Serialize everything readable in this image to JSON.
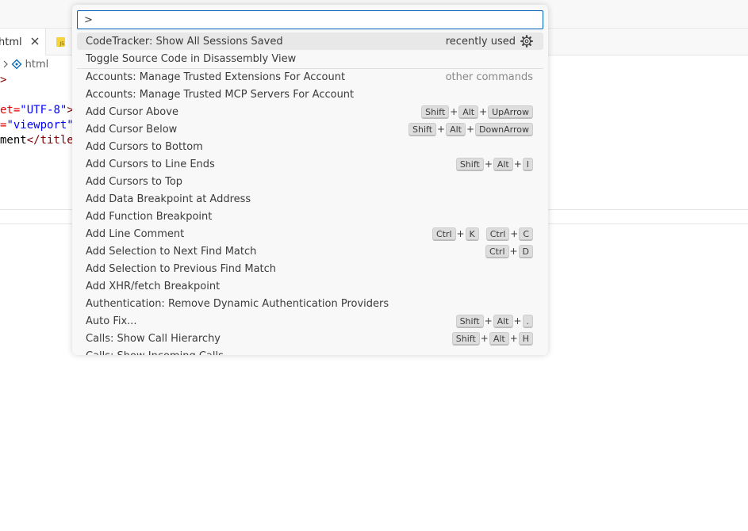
{
  "editor": {
    "active_tab_label": "html",
    "breadcrumb_prev": "l",
    "breadcrumb_current": "html",
    "code": {
      "line1_tag": ">",
      "line2_attr": "et=",
      "line2_str": "\"UTF-8\"",
      "line2_tag": ">",
      "line3_attr": "=",
      "line3_str": "\"viewport\"",
      "line4_text": "ment",
      "line4_tag": "</title"
    },
    "second_tab_icon": "js-file-icon",
    "second_tab_icon_text": "JS"
  },
  "palette": {
    "input_value": ">",
    "items": [
      {
        "label": "CodeTracker: Show All Sessions Saved",
        "note": "recently used",
        "icon": "gear-icon",
        "keys": []
      },
      {
        "label": "Toggle Source Code in Disassembly View",
        "keys": []
      },
      {
        "label": "Accounts: Manage Trusted Extensions For Account",
        "note": "other commands",
        "keys": []
      },
      {
        "label": "Accounts: Manage Trusted MCP Servers For Account",
        "keys": []
      },
      {
        "label": "Add Cursor Above",
        "keys": [
          [
            "Shift",
            "Alt",
            "UpArrow"
          ]
        ]
      },
      {
        "label": "Add Cursor Below",
        "keys": [
          [
            "Shift",
            "Alt",
            "DownArrow"
          ]
        ]
      },
      {
        "label": "Add Cursors to Bottom",
        "keys": []
      },
      {
        "label": "Add Cursors to Line Ends",
        "keys": [
          [
            "Shift",
            "Alt",
            "I"
          ]
        ]
      },
      {
        "label": "Add Cursors to Top",
        "keys": []
      },
      {
        "label": "Add Data Breakpoint at Address",
        "keys": []
      },
      {
        "label": "Add Function Breakpoint",
        "keys": []
      },
      {
        "label": "Add Line Comment",
        "keys": [
          [
            "Ctrl",
            "K"
          ],
          [
            "Ctrl",
            "C"
          ]
        ]
      },
      {
        "label": "Add Selection to Next Find Match",
        "keys": [
          [
            "Ctrl",
            "D"
          ]
        ]
      },
      {
        "label": "Add Selection to Previous Find Match",
        "keys": []
      },
      {
        "label": "Add XHR/fetch Breakpoint",
        "keys": []
      },
      {
        "label": "Authentication: Remove Dynamic Authentication Providers",
        "keys": []
      },
      {
        "label": "Auto Fix...",
        "keys": [
          [
            "Shift",
            "Alt",
            "."
          ]
        ]
      },
      {
        "label": "Calls: Show Call Hierarchy",
        "keys": [
          [
            "Shift",
            "Alt",
            "H"
          ]
        ]
      },
      {
        "label": "Calls: Show Incoming Calls",
        "keys": []
      }
    ],
    "plus": "+"
  }
}
